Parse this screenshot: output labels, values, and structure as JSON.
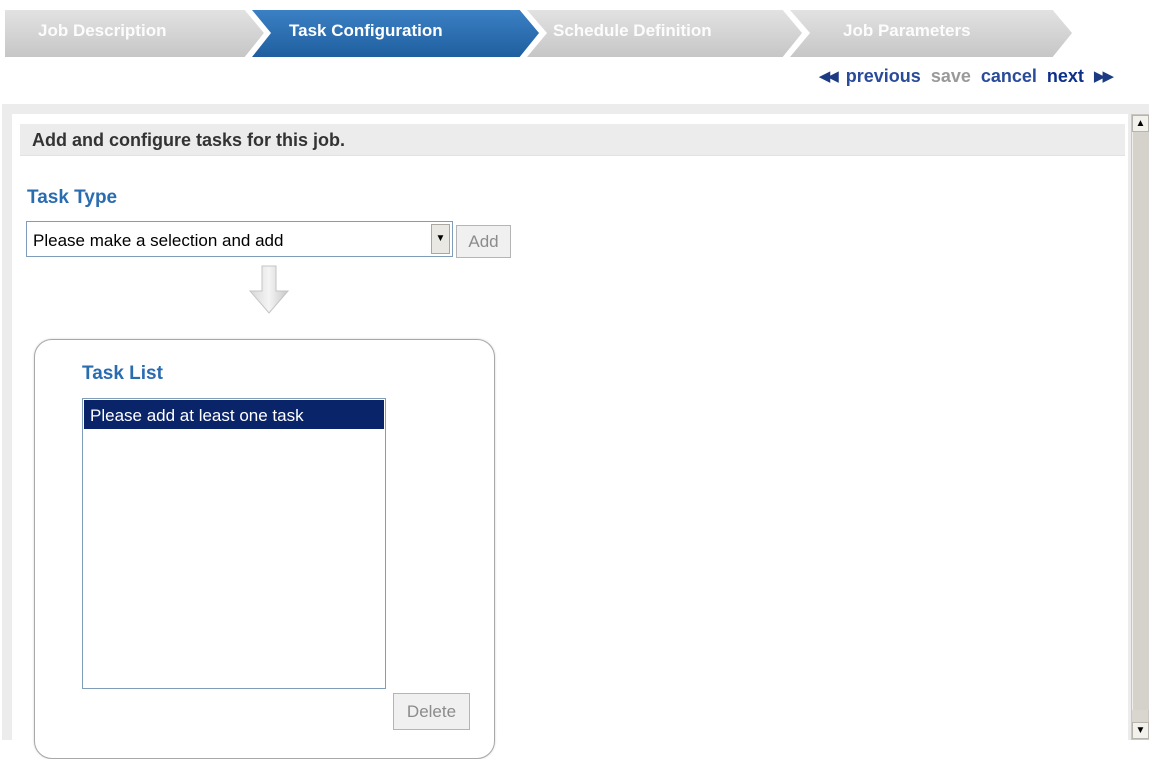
{
  "wizard": {
    "steps": [
      {
        "label": "Job Description",
        "state": "inactive"
      },
      {
        "label": "Task Configuration",
        "state": "active"
      },
      {
        "label": "Schedule Definition",
        "state": "inactive"
      },
      {
        "label": "Job Parameters",
        "state": "inactive"
      }
    ]
  },
  "actions": {
    "previous_arrows": "◀◀",
    "previous_label": "previous",
    "save_label": "save",
    "cancel_label": "cancel",
    "next_label": "next",
    "next_arrows": "▶▶"
  },
  "instructions": "Add and configure tasks for this job.",
  "task_type": {
    "heading": "Task Type",
    "select_value": "Please make a selection and add",
    "add_label": "Add"
  },
  "task_list": {
    "heading": "Task List",
    "items": [
      "Please add at least one task"
    ],
    "delete_label": "Delete"
  },
  "colors": {
    "active_step": "#2a6cb0",
    "inactive_step": "#d2d2d2",
    "heading_blue": "#2a6cb0",
    "selection": "#0a246a"
  },
  "icons": {
    "previous": "double-left-arrow-icon",
    "next": "double-right-arrow-icon",
    "flow": "down-arrow-icon",
    "dropdown": "chevron-down-icon"
  }
}
